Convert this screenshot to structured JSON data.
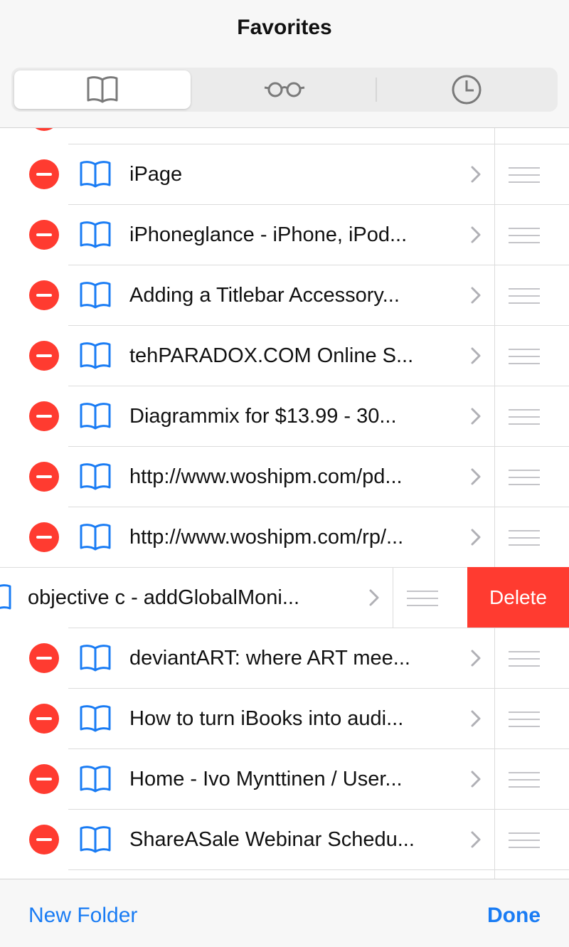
{
  "header": {
    "title": "Favorites",
    "tabs": [
      {
        "icon": "book-icon",
        "selected": true
      },
      {
        "icon": "reading-glasses-icon",
        "selected": false
      },
      {
        "icon": "clock-icon",
        "selected": false
      }
    ]
  },
  "bookmarks": [
    {
      "title": "iPage"
    },
    {
      "title": "iPhoneglance - iPhone, iPod..."
    },
    {
      "title": "Adding a Titlebar Accessory..."
    },
    {
      "title": "tehPARADOX.COM Online S..."
    },
    {
      "title": "Diagrammix for $13.99 - 30..."
    },
    {
      "title": "http://www.woshipm.com/pd..."
    },
    {
      "title": "http://www.woshipm.com/rp/..."
    },
    {
      "title": "objective c - addGlobalMoni..."
    },
    {
      "title": "deviantART: where ART mee..."
    },
    {
      "title": "How to turn iBooks into audi..."
    },
    {
      "title": "Home - Ivo Mynttinen / User..."
    },
    {
      "title": "ShareASale Webinar Schedu..."
    }
  ],
  "swipe_action": {
    "label": "Delete"
  },
  "toolbar": {
    "new_folder_label": "New Folder",
    "done_label": "Done"
  },
  "colors": {
    "accent": "#1a7cf4",
    "destructive": "#ff3b30",
    "icon_gray": "#8e8e93"
  }
}
